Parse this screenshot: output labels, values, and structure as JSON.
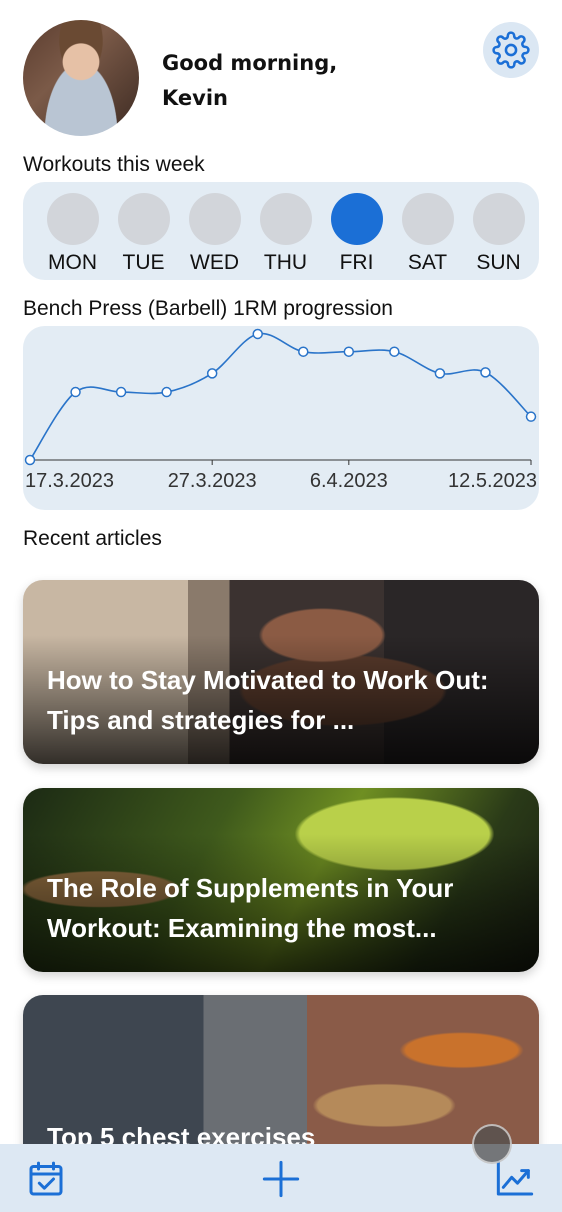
{
  "header": {
    "greeting_line1": "Good morning,",
    "greeting_line2": "Kevin",
    "settings_icon": "gear-icon"
  },
  "workouts": {
    "title": "Workouts this week",
    "days": [
      {
        "label": "MON",
        "done": false
      },
      {
        "label": "TUE",
        "done": false
      },
      {
        "label": "WED",
        "done": false
      },
      {
        "label": "THU",
        "done": false
      },
      {
        "label": "FRI",
        "done": true
      },
      {
        "label": "SAT",
        "done": false
      },
      {
        "label": "SUN",
        "done": false
      }
    ],
    "active_color": "#1b6fd6",
    "inactive_color": "#d2d5da"
  },
  "progress": {
    "title": "Bench Press (Barbell) 1RM progression"
  },
  "chart_data": {
    "type": "line",
    "title": "Bench Press (Barbell) 1RM progression",
    "xlabel": "",
    "ylabel": "",
    "x_tick_labels": [
      "17.3.2023",
      "27.3.2023",
      "6.4.2023",
      "12.5.2023"
    ],
    "series": [
      {
        "values": [
          0,
          69,
          69,
          69,
          88,
          128,
          110,
          110,
          110,
          88,
          89,
          44
        ]
      }
    ],
    "ylim": [
      0,
      130
    ],
    "grid": false,
    "color": "#2a74c9"
  },
  "articles": {
    "title": "Recent articles",
    "items": [
      {
        "title": "How to Stay Motivated to Work Out: Tips and strategies for ..."
      },
      {
        "title": "The Role of Supplements in Your Workout: Examining the most..."
      },
      {
        "title": "Top 5 chest exercises"
      }
    ]
  },
  "tabbar": {
    "items": [
      {
        "icon": "calendar-check-icon"
      },
      {
        "icon": "plus-icon"
      },
      {
        "icon": "chart-line-icon"
      }
    ],
    "accent": "#1b6fd6"
  }
}
